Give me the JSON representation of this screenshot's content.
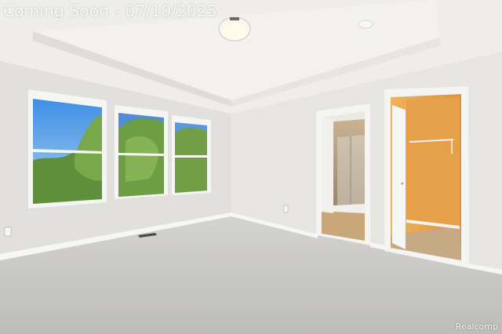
{
  "overlay": {
    "caption": "Coming Soon - 07/10/2025"
  },
  "watermark": {
    "text": "Realcomp"
  },
  "colors": {
    "wall": "#e4e3df",
    "ceiling": "#eeedea",
    "carpet": "#c9c8c5",
    "closet_wall": "#e2a24a",
    "bath_tile": "#b39a78",
    "trim": "#f4f4f2"
  }
}
